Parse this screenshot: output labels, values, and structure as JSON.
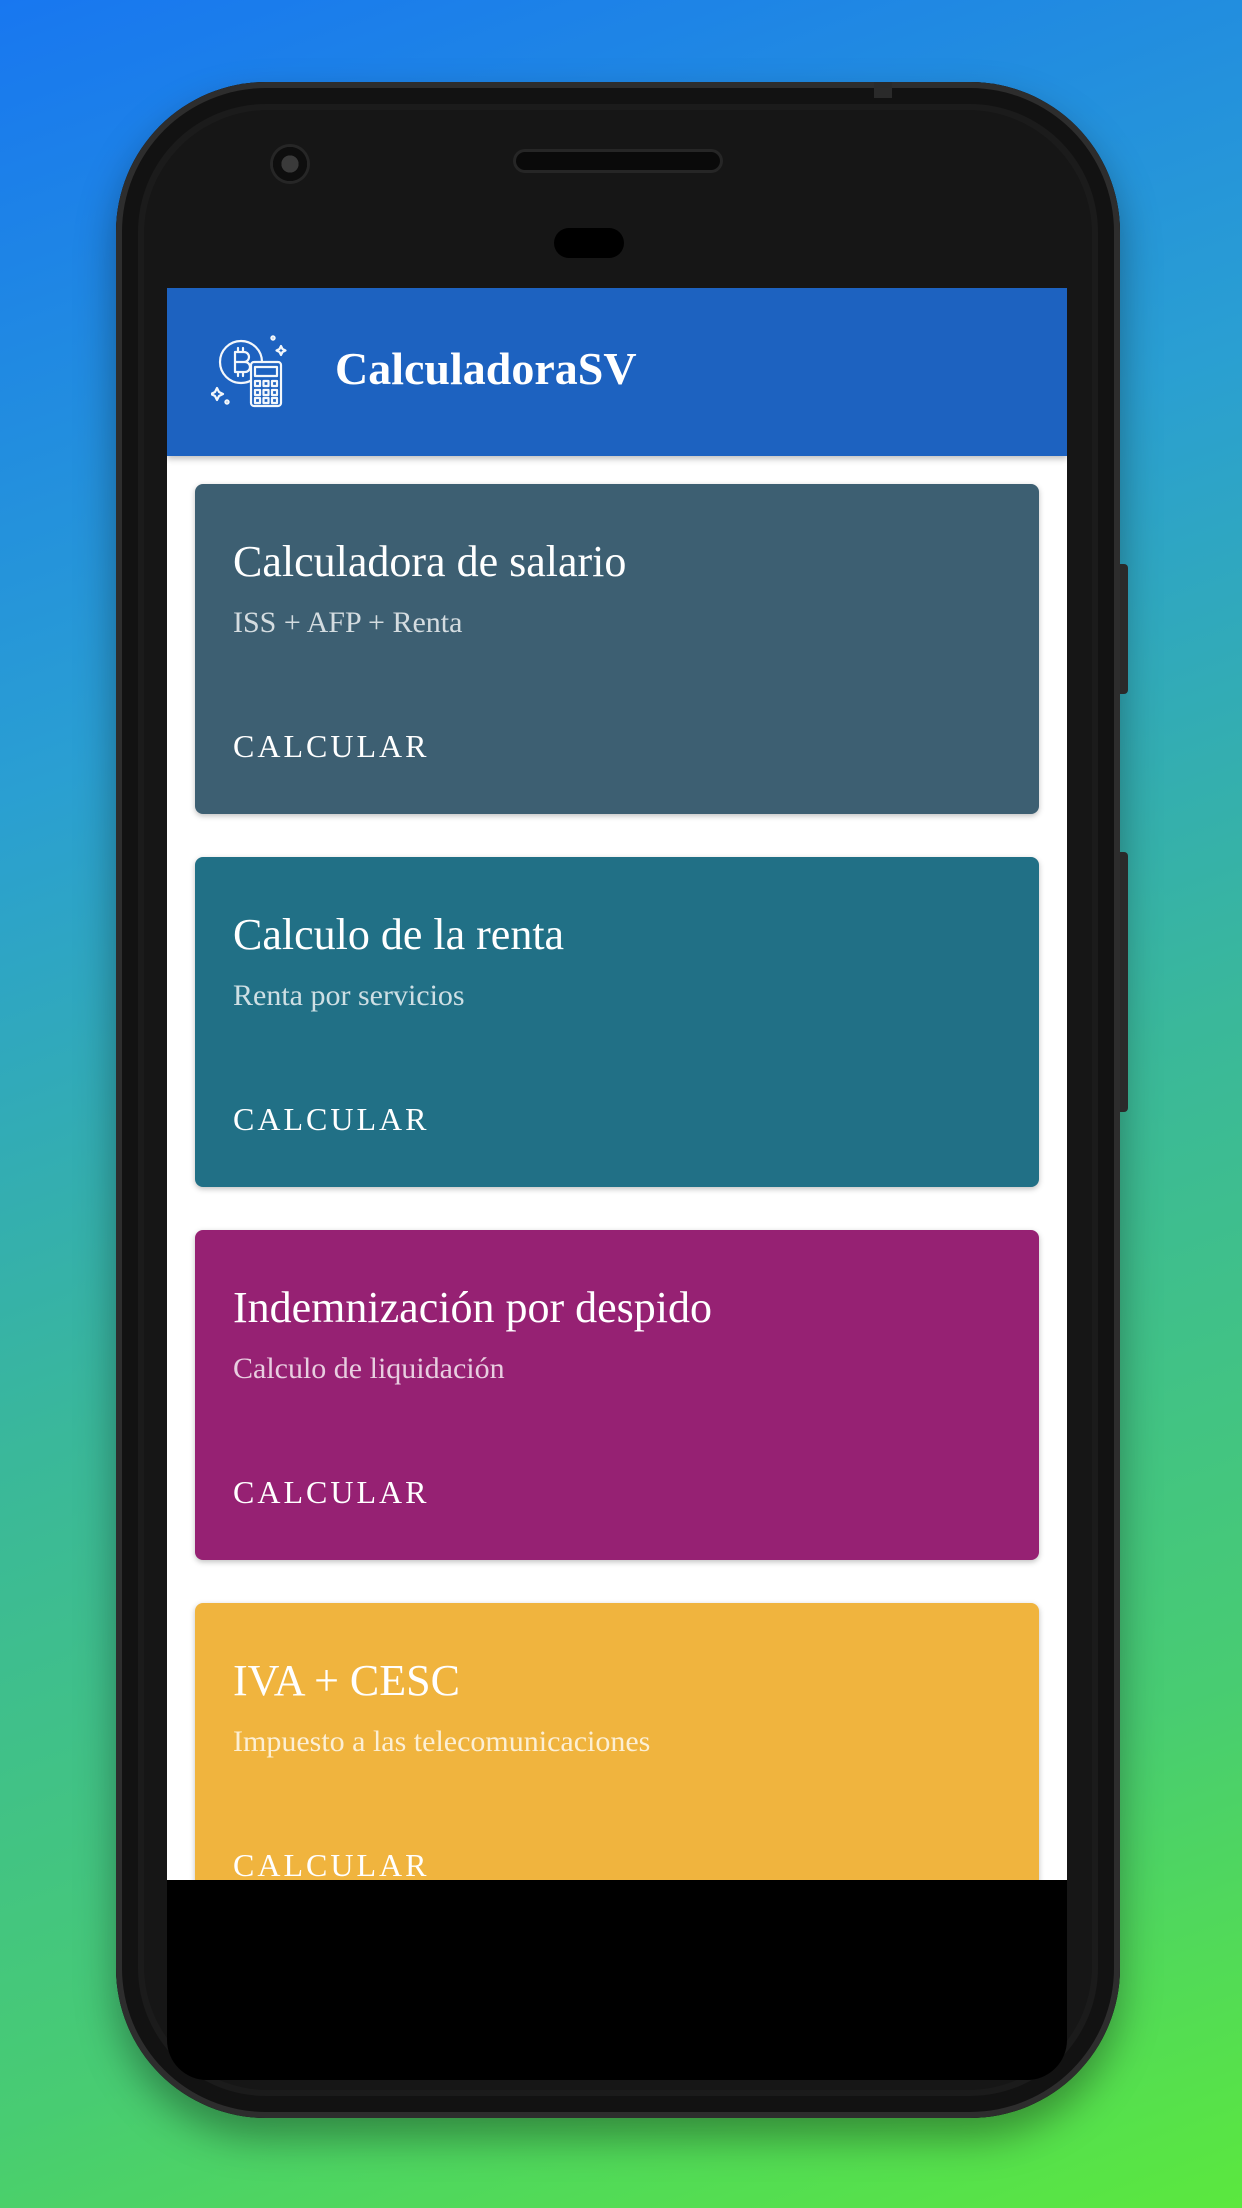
{
  "app": {
    "title": "CalculadoraSV",
    "logo_icon": "bitcoin-calculator-icon",
    "appbar_color": "#1d62c0"
  },
  "cards": [
    {
      "title": "Calculadora de salario",
      "subtitle": "ISS + AFP + Renta",
      "action": "CALCULAR",
      "color": "#3d5f72"
    },
    {
      "title": "Calculo de la renta",
      "subtitle": "Renta por servicios",
      "action": "CALCULAR",
      "color": "#217086"
    },
    {
      "title": "Indemnización por despido",
      "subtitle": "Calculo de liquidación",
      "action": "CALCULAR",
      "color": "#962173"
    },
    {
      "title": "IVA + CESC",
      "subtitle": "Impuesto a las telecomunicaciones",
      "action": "CALCULAR",
      "color": "#f0b43e"
    }
  ]
}
